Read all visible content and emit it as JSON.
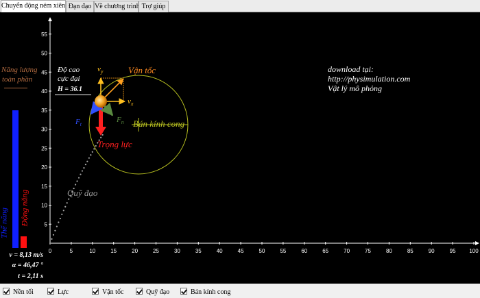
{
  "tabs": [
    {
      "label": "Chuyển động ném xiên",
      "active": true
    },
    {
      "label": "Đạn đạo",
      "active": false
    },
    {
      "label": "Về chương trình",
      "active": false
    },
    {
      "label": "Trợ giúp",
      "active": false
    }
  ],
  "graph": {
    "x_ticks": [
      "0",
      "5",
      "10",
      "15",
      "20",
      "25",
      "30",
      "35",
      "40",
      "45",
      "50",
      "55",
      "60",
      "65",
      "70",
      "75",
      "80",
      "85",
      "90",
      "95",
      "100"
    ],
    "y_ticks": [
      "5",
      "10",
      "15",
      "20",
      "25",
      "30",
      "35",
      "40",
      "45",
      "50",
      "55"
    ],
    "x_range": [
      0,
      100
    ],
    "y_range": [
      0,
      55
    ]
  },
  "energy": {
    "total_label_line1": "Năng lượng",
    "total_label_line2": "toàn phần",
    "potential_label": "Thế năng",
    "kinetic_label": "Động năng",
    "potential_fraction": 0.92,
    "kinetic_fraction": 0.08,
    "colors": {
      "potential": "#1020ff",
      "kinetic": "#ff1010",
      "total": "#b06a40"
    }
  },
  "height": {
    "title_line1": "Độ cao",
    "title_line2": "cực đại",
    "value": "H = 36.1"
  },
  "vectors": {
    "velocity": "Vận tốc",
    "vy": "v",
    "vy_sub": "y",
    "vx": "v",
    "vx_sub": "x",
    "gravity": "Trọng lực",
    "normal": "F",
    "normal_sub": "n",
    "tangent": "F",
    "tangent_sub": "t",
    "radius": "Bán kính cong"
  },
  "trajectory_label": "Quỹ đạo",
  "download": {
    "line1": "download tại:",
    "line2": "http://physimulation.com",
    "line3": "Vật lý mô phỏng"
  },
  "readouts": {
    "v": "v = 8,13 m/s",
    "alpha": "α = 46,47 °",
    "t": "t = 2,11 s"
  },
  "checkboxes": [
    {
      "label": "Nền tối",
      "checked": true
    },
    {
      "label": "Lực",
      "checked": true
    },
    {
      "label": "Vận tốc",
      "checked": true
    },
    {
      "label": "Quỹ đạo",
      "checked": true
    },
    {
      "label": "Bán kính cong",
      "checked": true
    }
  ],
  "trajectory_points": [
    [
      0,
      0
    ],
    [
      0.4,
      1.1
    ],
    [
      0.8,
      2.2
    ],
    [
      1.2,
      3.3
    ],
    [
      1.6,
      4.4
    ],
    [
      2.0,
      5.5
    ],
    [
      2.4,
      6.5
    ],
    [
      2.8,
      7.6
    ],
    [
      3.2,
      8.6
    ],
    [
      3.6,
      9.6
    ],
    [
      4.0,
      10.6
    ],
    [
      4.4,
      11.6
    ],
    [
      4.8,
      12.5
    ],
    [
      5.2,
      13.5
    ],
    [
      5.6,
      14.4
    ],
    [
      6.0,
      15.4
    ],
    [
      6.4,
      16.3
    ],
    [
      6.8,
      17.2
    ],
    [
      7.2,
      18.1
    ],
    [
      7.6,
      19.0
    ],
    [
      8.0,
      19.8
    ],
    [
      8.4,
      20.7
    ],
    [
      8.8,
      21.5
    ],
    [
      9.2,
      22.4
    ],
    [
      9.6,
      23.2
    ],
    [
      10.0,
      24.0
    ],
    [
      10.4,
      24.8
    ],
    [
      10.8,
      25.6
    ],
    [
      11.2,
      26.4
    ],
    [
      11.6,
      27.1
    ],
    [
      12.0,
      27.8
    ],
    [
      12.4,
      28.5
    ]
  ],
  "ball": {
    "x": 12.2,
    "y": 35.3
  }
}
